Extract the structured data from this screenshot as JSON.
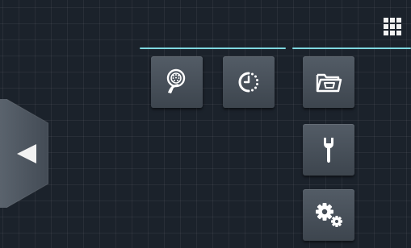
{
  "screen": {
    "background_color": "#1b222b",
    "grid_color": "#2c343d"
  },
  "header": {
    "menu_icon": "grid-menu-icon",
    "accent_color": "#7fd8e0"
  },
  "panels": {
    "left_group": [
      {
        "id": "cleaning",
        "icon": "cleaning-shower-icon"
      },
      {
        "id": "timer",
        "icon": "timer-icon"
      }
    ],
    "right_group": [
      {
        "id": "folder",
        "icon": "folder-basket-icon"
      },
      {
        "id": "service",
        "icon": "wrench-icon"
      },
      {
        "id": "settings",
        "icon": "gears-icon"
      }
    ]
  },
  "side_handle": {
    "icon": "triangle-left-icon"
  }
}
